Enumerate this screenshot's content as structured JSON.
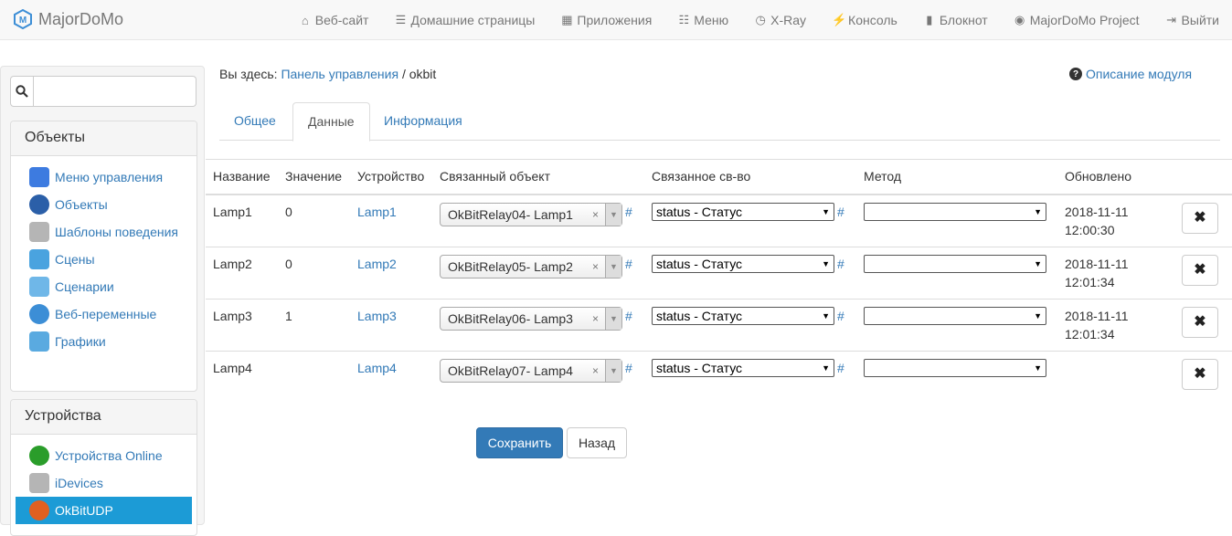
{
  "app": {
    "brand": "MajorDoMo"
  },
  "nav": [
    {
      "icon": "home-icon",
      "glyph": "⌂",
      "label": "Веб-сайт"
    },
    {
      "icon": "list-icon",
      "glyph": "☰",
      "label": "Домашние страницы"
    },
    {
      "icon": "apps-icon",
      "glyph": "▦",
      "label": "Приложения"
    },
    {
      "icon": "menu-icon",
      "glyph": "☷",
      "label": "Меню"
    },
    {
      "icon": "dashboard-icon",
      "glyph": "◷",
      "label": "X-Ray"
    },
    {
      "icon": "bolt-icon",
      "glyph": "⚡",
      "label": "Консоль"
    },
    {
      "icon": "notebook-icon",
      "glyph": "▮",
      "label": "Блокнот"
    },
    {
      "icon": "globe-icon",
      "glyph": "◉",
      "label": "MajorDoMo Project"
    },
    {
      "icon": "logout-icon",
      "glyph": "⇥",
      "label": "Выйти"
    }
  ],
  "sidebar": {
    "search_placeholder": "",
    "panels": [
      {
        "title": "Объекты",
        "items": [
          {
            "label": "Меню управления",
            "icon": "menu-control-icon",
            "color": "#3d7be0"
          },
          {
            "label": "Объекты",
            "icon": "globe-objects-icon",
            "color": "#2b5fa8"
          },
          {
            "label": "Шаблоны поведения",
            "icon": "templates-icon",
            "color": "#b5b5b5"
          },
          {
            "label": "Сцены",
            "icon": "scenes-icon",
            "color": "#4aa3df"
          },
          {
            "label": "Сценарии",
            "icon": "scripts-icon",
            "color": "#6fb7e8"
          },
          {
            "label": "Веб-переменные",
            "icon": "web-vars-icon",
            "color": "#3c8ed6"
          },
          {
            "label": "Графики",
            "icon": "charts-icon",
            "color": "#5aaae0"
          }
        ]
      },
      {
        "title": "Устройства",
        "items": [
          {
            "label": "Устройства Online",
            "icon": "devices-online-icon",
            "color": "#2a9d2a"
          },
          {
            "label": "iDevices",
            "icon": "idevices-icon",
            "color": "#b5b5b5"
          },
          {
            "label": "OkBitUDP",
            "icon": "okbit-icon",
            "color": "#e06020",
            "active": true
          }
        ]
      }
    ]
  },
  "breadcrumb": {
    "prefix": "Вы здесь:",
    "link": "Панель управления",
    "sep": "/",
    "current": "okbit"
  },
  "help": {
    "label": "Описание модуля"
  },
  "tabs": [
    {
      "label": "Общее"
    },
    {
      "label": "Данные",
      "active": true
    },
    {
      "label": "Информация"
    }
  ],
  "table": {
    "headers": [
      "Название",
      "Значение",
      "Устройство",
      "Связанный объект",
      "Связанное св-во",
      "Метод",
      "Обновлено",
      ""
    ],
    "rows": [
      {
        "name": "Lamp1",
        "value": "0",
        "device": "Lamp1",
        "object": "OkBitRelay04- Lamp1",
        "property": "status - Статус",
        "method": "",
        "updated_date": "2018-11-11",
        "updated_time": "12:00:30"
      },
      {
        "name": "Lamp2",
        "value": "0",
        "device": "Lamp2",
        "object": "OkBitRelay05- Lamp2",
        "property": "status - Статус",
        "method": "",
        "updated_date": "2018-11-11",
        "updated_time": "12:01:34"
      },
      {
        "name": "Lamp3",
        "value": "1",
        "device": "Lamp3",
        "object": "OkBitRelay06- Lamp3",
        "property": "status - Статус",
        "method": "",
        "updated_date": "2018-11-11",
        "updated_time": "12:01:34"
      },
      {
        "name": "Lamp4",
        "value": "",
        "device": "Lamp4",
        "object": "OkBitRelay07- Lamp4",
        "property": "status - Статус",
        "method": "",
        "updated_date": "",
        "updated_time": ""
      }
    ],
    "hash": "#",
    "clear_glyph": "×",
    "delete_glyph": "✖"
  },
  "buttons": {
    "save": "Сохранить",
    "back": "Назад"
  }
}
